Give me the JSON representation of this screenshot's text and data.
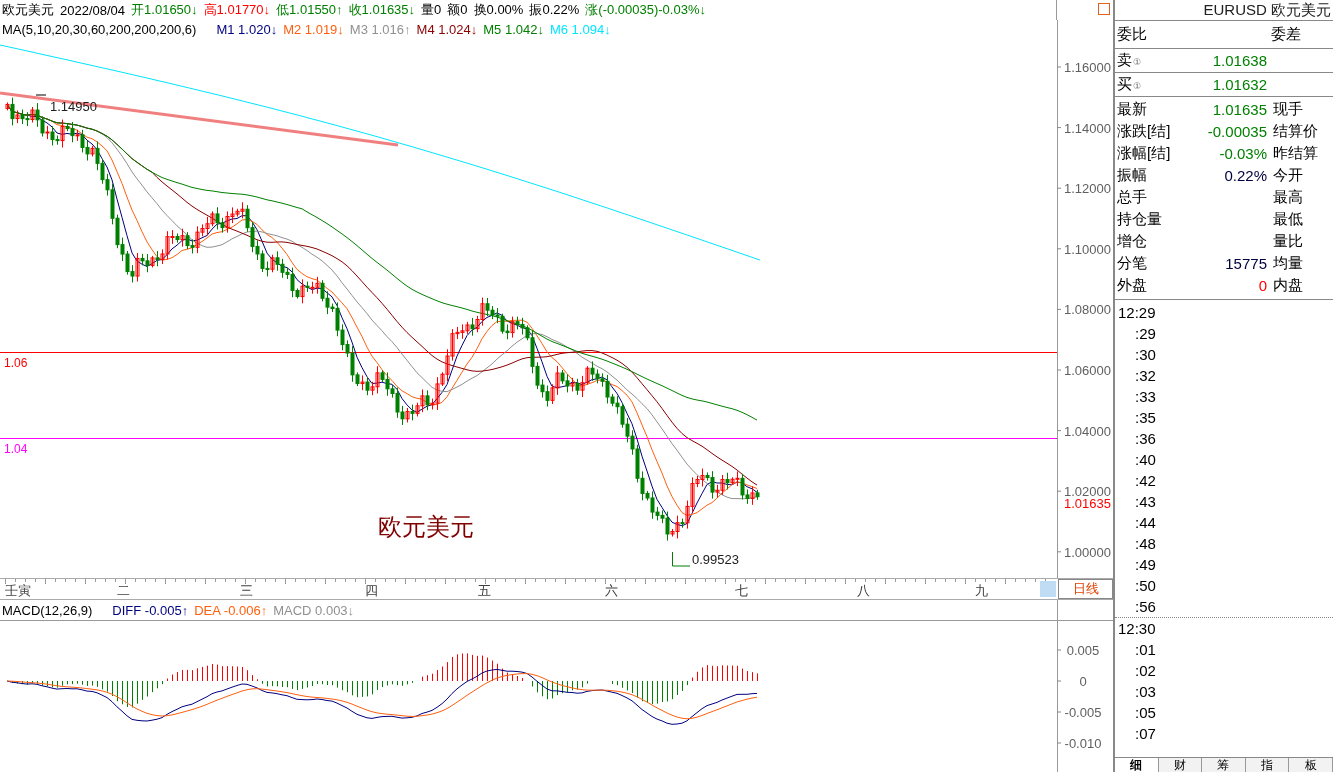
{
  "quote_header": {
    "name": "欧元美元",
    "date": "2022/08/04",
    "fields": [
      {
        "text": "开1.01650↓",
        "color": "#008000"
      },
      {
        "text": "高1.01770↓",
        "color": "#ff0000"
      },
      {
        "text": "低1.01550↑",
        "color": "#008000"
      },
      {
        "text": "收1.01635↓",
        "color": "#008000"
      },
      {
        "text": "量0"
      },
      {
        "text": "额0"
      },
      {
        "text": "换0.00%"
      },
      {
        "text": "振0.22%"
      },
      {
        "text": "涨(-0.00035)-0.03%↓",
        "color": "#008000"
      }
    ]
  },
  "ma_legend": {
    "title": "MA(5,10,20,30,60,200,200,200,6)",
    "items": [
      {
        "label": "M1",
        "value": "1.020↓",
        "color": "#000080"
      },
      {
        "label": "M2",
        "value": "1.019↓",
        "color": "#ff6010"
      },
      {
        "label": "M3",
        "value": "1.016↑",
        "color": "#909090"
      },
      {
        "label": "M4",
        "value": "1.024↓",
        "color": "#8b0000"
      },
      {
        "label": "M5",
        "value": "1.042↓",
        "color": "#008000"
      },
      {
        "label": "M6",
        "value": "1.094↓",
        "color": "#00e5ff"
      }
    ]
  },
  "price_chart": {
    "axis_ticks": [
      "1.16000",
      "1.14000",
      "1.12000",
      "1.10000",
      "1.08000",
      "1.06000",
      "1.04000",
      "1.02000",
      "1.00000"
    ],
    "current_price": "1.01635",
    "high_label": "1.14950",
    "low_label": "0.99523",
    "overlay_title": "欧元美元",
    "level_lines": [
      {
        "label": "1.06",
        "color": "#ff0000"
      },
      {
        "label": "1.04",
        "color": "#ff00ff"
      }
    ]
  },
  "time_axis": {
    "labels": [
      "壬寅",
      "二",
      "三",
      "四",
      "五",
      "六",
      "七",
      "八",
      "九"
    ],
    "period_button": "日线"
  },
  "macd": {
    "title": "MACD(12,26,9)",
    "items": [
      {
        "label": "DIFF",
        "value": "-0.005↑",
        "color": "#000080"
      },
      {
        "label": "DEA",
        "value": "-0.006↑",
        "color": "#ff6010"
      },
      {
        "label": "MACD",
        "value": "0.003↓",
        "color": "#909090"
      }
    ],
    "axis_ticks": [
      "0.005",
      "0",
      "-0.005",
      "-0.010"
    ]
  },
  "quote_panel": {
    "title": "EURUSD 欧元美元",
    "header": {
      "left": "委比",
      "right": "委差"
    },
    "book": [
      {
        "label": "卖",
        "badge": "①",
        "value": "1.01638",
        "color": "#008000"
      },
      {
        "label": "买",
        "badge": "①",
        "value": "1.01632",
        "color": "#008000"
      }
    ],
    "stats": [
      {
        "label": "最新",
        "value": "1.01635",
        "color": "#008000",
        "right_label": "现手"
      },
      {
        "label": "涨跌[结]",
        "value": "-0.00035",
        "color": "#008000",
        "right_label": "结算价"
      },
      {
        "label": "涨幅[结]",
        "value": "-0.03%",
        "color": "#008000",
        "right_label": "昨结算"
      },
      {
        "label": "振幅",
        "value": "0.22%",
        "color": "#000040",
        "right_label": "今开"
      },
      {
        "label": "总手",
        "right_label": "最高"
      },
      {
        "label": "持仓量",
        "right_label": "最低"
      },
      {
        "label": "增仓",
        "right_label": "量比"
      },
      {
        "label": "分笔",
        "value": "15775",
        "color": "#000040",
        "right_label": "均量"
      },
      {
        "label": "外盘",
        "value": "0",
        "color": "#ff0000",
        "right_label": "内盘"
      }
    ]
  },
  "tick_list": [
    {
      "hour": "12:29",
      "minutes": [
        ":29",
        ":30",
        ":32",
        ":33",
        ":35",
        ":36",
        ":40",
        ":42",
        ":43",
        ":44",
        ":48",
        ":49",
        ":50",
        ":56"
      ]
    },
    {
      "hour": "12:30",
      "minutes": [
        ":01",
        ":02",
        ":03",
        ":05",
        ":07"
      ]
    }
  ],
  "bottom_tabs": [
    {
      "label": "细",
      "selected": true
    },
    {
      "label": "财",
      "selected": false
    },
    {
      "label": "筹",
      "selected": false
    },
    {
      "label": "指",
      "selected": false
    },
    {
      "label": "板",
      "selected": false
    }
  ]
}
